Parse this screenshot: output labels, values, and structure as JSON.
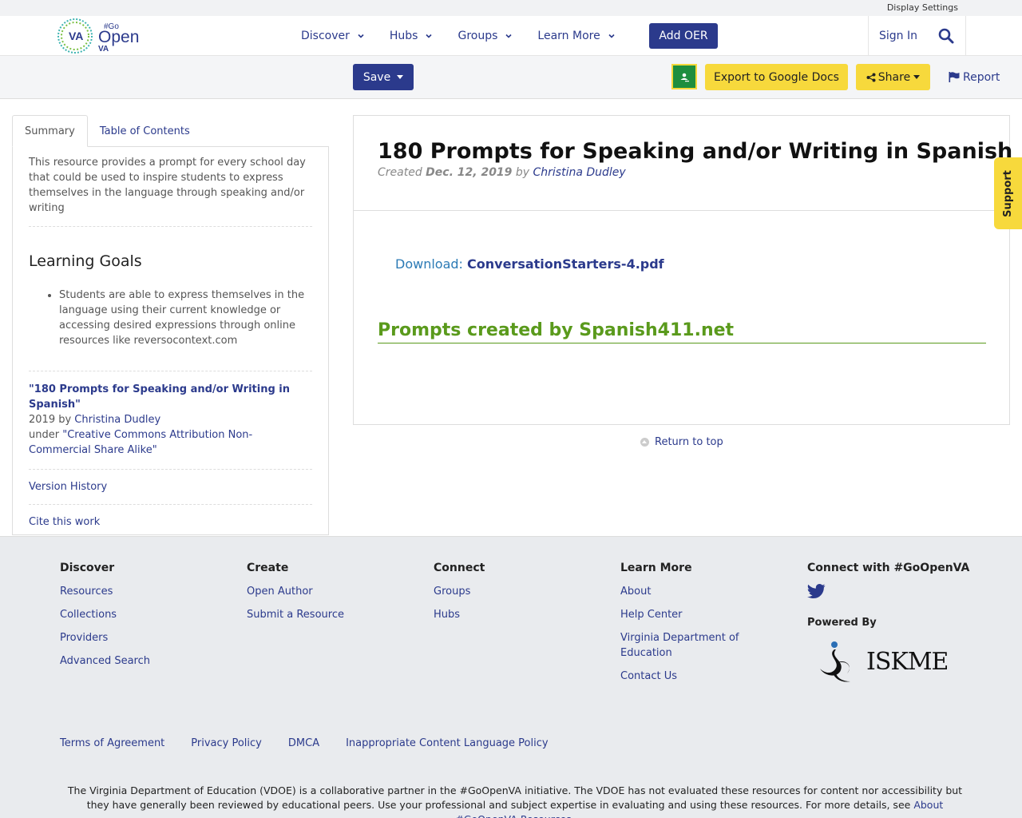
{
  "utility": {
    "display_settings": "Display Settings"
  },
  "header": {
    "logo": {
      "va": "VA",
      "go": "#Go",
      "open": "Open",
      "va_small": "VA"
    },
    "nav": [
      {
        "label": "Discover"
      },
      {
        "label": "Hubs"
      },
      {
        "label": "Groups"
      },
      {
        "label": "Learn More"
      }
    ],
    "add_oer": "Add OER",
    "sign_in": "Sign In"
  },
  "toolbar": {
    "save": "Save",
    "export": "Export to Google Docs",
    "share": "Share",
    "report": "Report"
  },
  "sidebar": {
    "tabs": [
      "Summary",
      "Table of Contents"
    ],
    "description": "This resource provides a prompt for every school day that could be used to inspire students to express themselves in the language through speaking and/or writing",
    "learning_goals_title": "Learning Goals",
    "learning_goals": [
      "Students are able to express themselves in the language using their current knowledge or accessing desired expressions through online resources like reversocontext.com"
    ],
    "attribution": {
      "title": "\"180 Prompts for Speaking and/or Writing in Spanish\"",
      "year_by": "2019 by ",
      "author": "Christina Dudley",
      "under": "under ",
      "license": "\"Creative Commons Attribution Non-Commercial Share Alike\""
    },
    "version_history": "Version History",
    "cite": "Cite this work"
  },
  "main": {
    "title": "180 Prompts for Speaking and/or Writing in Spanish",
    "created_label": "Created ",
    "created_date": "Dec. 12, 2019",
    "by": " by ",
    "author": "Christina Dudley",
    "download_label": "Download: ",
    "download_file": "ConversationStarters-4.pdf",
    "prompts_heading": "Prompts created by Spanish411.net"
  },
  "return_to_top": "Return to top",
  "support": "Support",
  "footer": {
    "columns": [
      {
        "title": "Discover",
        "links": [
          "Resources",
          "Collections",
          "Providers",
          "Advanced Search"
        ]
      },
      {
        "title": "Create",
        "links": [
          "Open Author",
          "Submit a Resource"
        ]
      },
      {
        "title": "Connect",
        "links": [
          "Groups",
          "Hubs"
        ]
      },
      {
        "title": "Learn More",
        "links": [
          "About",
          "Help Center",
          "Virginia Department of Education",
          "Contact Us"
        ]
      }
    ],
    "connect_title": "Connect with #GoOpenVA",
    "powered_by": "Powered By",
    "iskme": "ISKME",
    "legal": [
      "Terms of Agreement",
      "Privacy Policy",
      "DMCA",
      "Inappropriate Content Language Policy"
    ],
    "disclaimer": "The Virginia Department of Education (VDOE) is a collaborative partner in the #GoOpenVA initiative. The VDOE has not evaluated these resources for content nor accessibility but they have generally been reviewed by educational peers. Use your professional and subject expertise in evaluating and using these resources. For more details, see ",
    "disclaimer_link": "About #GoOpenVA Resources",
    "disclaimer_end": "."
  },
  "colors": {
    "brand_navy": "#2b3a8c",
    "accent_yellow": "#f7d93c",
    "heading_green": "#5a9a1c"
  }
}
